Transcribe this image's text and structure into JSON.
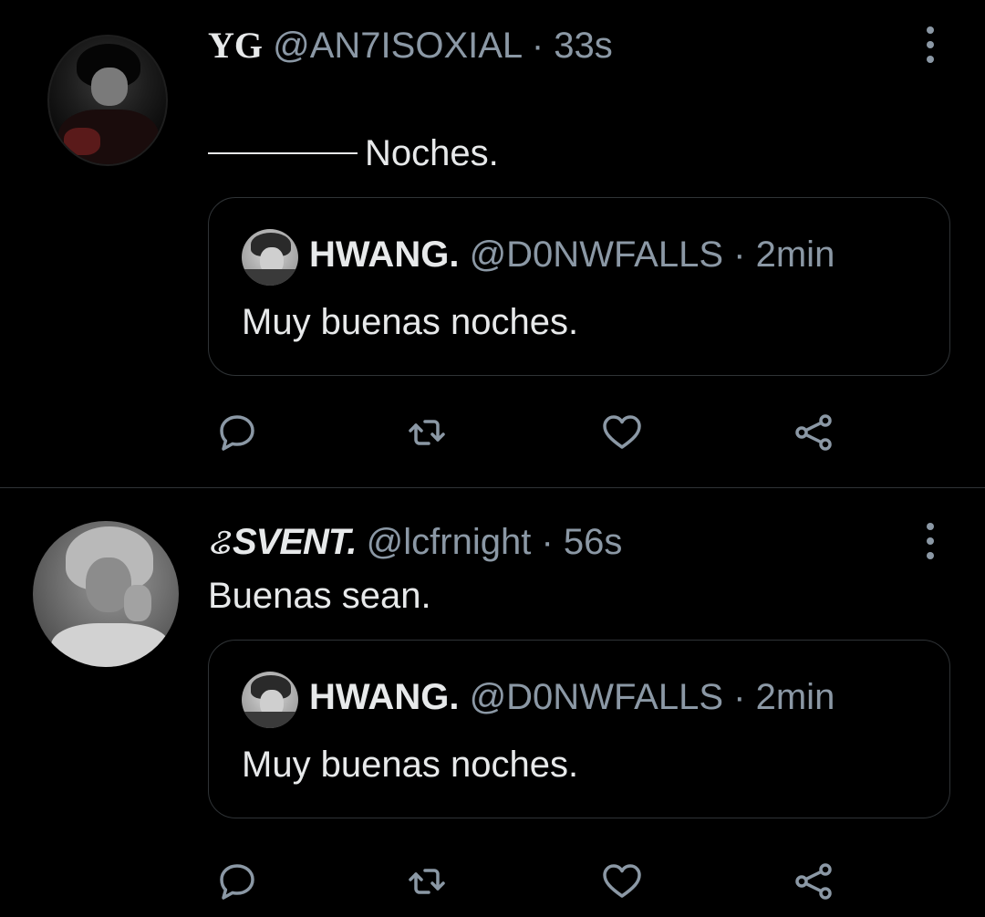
{
  "tweets": [
    {
      "name": "YG",
      "handle": "@AN7ISOXIAL",
      "separator": "·",
      "time": "33s",
      "text": "Noches.",
      "quote": {
        "name": "HWANG.",
        "handle": "@D0NWFALLS",
        "separator": "·",
        "time": "2min",
        "text": "Muy buenas noches."
      }
    },
    {
      "badge": "ଌ",
      "name": "SVENT.",
      "handle": "@lcfrnight",
      "separator": "·",
      "time": "56s",
      "text": "Buenas sean.",
      "quote": {
        "name": "HWANG.",
        "handle": "@D0NWFALLS",
        "separator": "·",
        "time": "2min",
        "text": "Muy buenas noches."
      }
    }
  ],
  "icons": {
    "reply": "reply-icon",
    "retweet": "retweet-icon",
    "like": "heart-icon",
    "share": "share-icon",
    "more": "more-vertical-icon"
  },
  "colors": {
    "background": "#000000",
    "text_primary": "#e7e9ea",
    "text_secondary": "#8b98a5",
    "border": "#2f3336"
  }
}
